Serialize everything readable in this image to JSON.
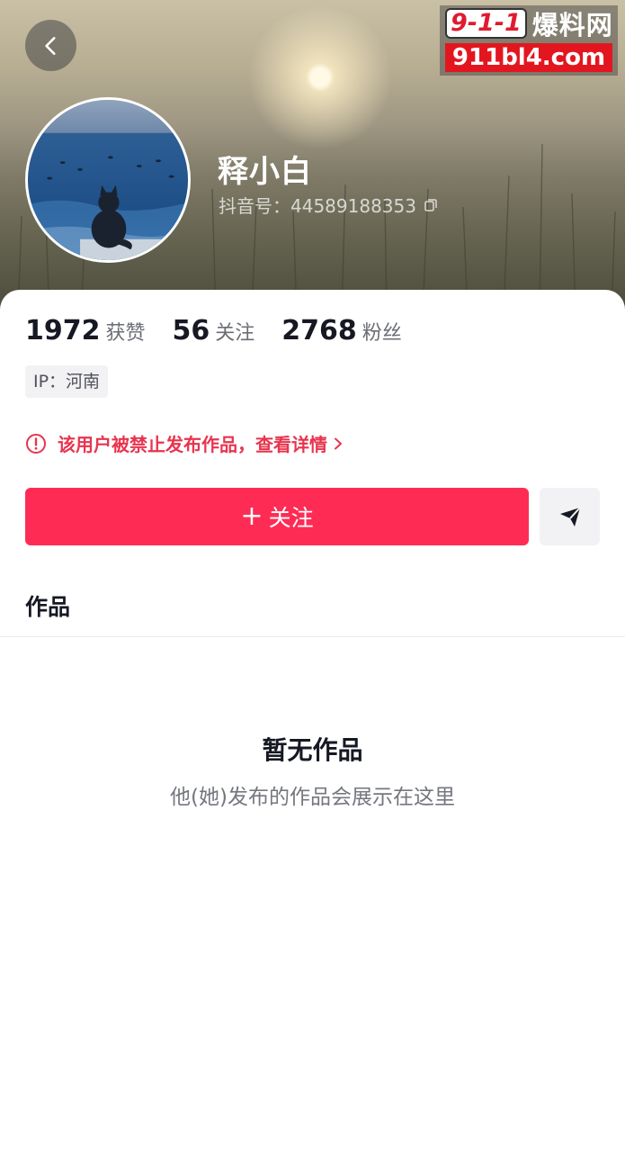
{
  "watermark": {
    "number": "9-1-1",
    "text": "爆料网",
    "domain": "911bl4.com"
  },
  "profile": {
    "nickname": "释小白",
    "douyin_id": "抖音号：44589188353",
    "likes": {
      "value": "1972",
      "label": "获赞"
    },
    "following": {
      "value": "56",
      "label": "关注"
    },
    "followers": {
      "value": "2768",
      "label": "粉丝"
    },
    "ip": "IP：河南"
  },
  "notice": {
    "text": "该用户被禁止发布作品，查看详情",
    "color": "#e8344e"
  },
  "actions": {
    "follow_plus": "+",
    "follow_label": "关注",
    "accent": "#fe2c55"
  },
  "tabs": {
    "works": "作品"
  },
  "empty": {
    "title": "暂无作品",
    "subtitle": "他(她)发布的作品会展示在这里"
  },
  "icons": [
    "back-arrow-icon",
    "copy-icon",
    "warning-icon",
    "chevron-right-icon",
    "share-icon"
  ]
}
